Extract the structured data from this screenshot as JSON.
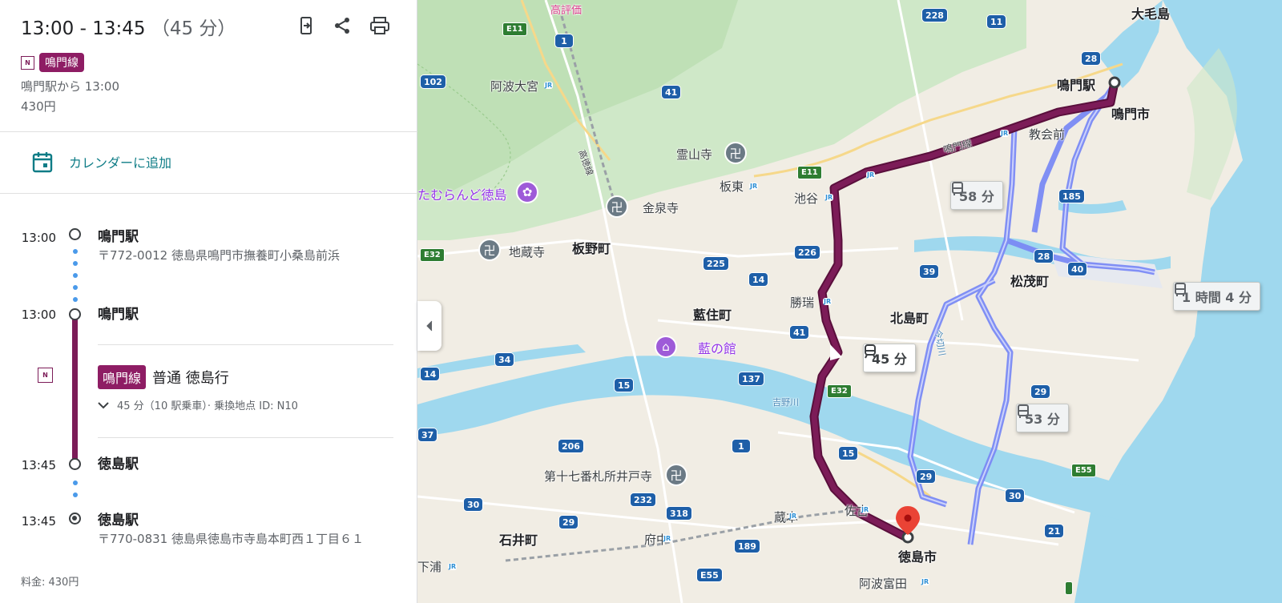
{
  "header": {
    "time_range": "13:00 - 13:45",
    "duration": "（45 分）",
    "line_badge": "N",
    "line_name": "鳴門線",
    "depart_text": "鳴門駅から 13:00",
    "price": "430円"
  },
  "calendar": {
    "label": "カレンダーに追加"
  },
  "itinerary": {
    "stop1": {
      "time": "13:00",
      "name": "鳴門駅",
      "address": "〒772-0012 徳島県鳴門市撫養町小桑島前浜"
    },
    "stop2": {
      "time": "13:00",
      "name": "鳴門駅"
    },
    "ride": {
      "badge": "N",
      "line": "鳴門線",
      "text": "普通 徳島行",
      "detail": "45 分（10 駅乗車）· 乗換地点 ID: N10"
    },
    "stop3": {
      "time": "13:45",
      "name": "徳島駅"
    },
    "stop4": {
      "time": "13:45",
      "name": "徳島駅",
      "address": "〒770-0831 徳島県徳島市寺島本町西１丁目６１"
    },
    "fare": "料金: 430円"
  },
  "map": {
    "places": {
      "naruto_station": "鳴門駅",
      "naruto_city": "鳴門市",
      "omoge": "大毛島",
      "kyokaimae": "教会前",
      "awaomiya": "阿波大宮",
      "ryozenji": "霊山寺",
      "bando": "板東",
      "ikenotani": "池谷",
      "tamuraland": "たむらんど徳島",
      "konsenji": "金泉寺",
      "jizoji": "地蔵寺",
      "itano": "板野町",
      "aizumi": "藍住町",
      "shozui": "勝瑞",
      "kitajima": "北島町",
      "matsushige": "松茂町",
      "ainoyakata": "藍の館",
      "yoshinogawa": "吉野川",
      "idoji": "第十七番札所井戸寺",
      "kuramoto": "蔵本",
      "sako": "佐古",
      "fuchu": "府中",
      "ishii": "石井町",
      "shimoura": "下浦",
      "tokushima_city": "徳島市",
      "awatomida": "阿波富田",
      "kohyoka": "高評価",
      "kotokusen": "高徳線",
      "naruto_line": "鳴門線",
      "imakire": "今切川"
    },
    "callouts": {
      "main": "45 分",
      "alt1": "58 分",
      "alt2": "53 分",
      "alt3": "1 時間 4 分"
    },
    "roads": [
      "228",
      "11",
      "28",
      "1",
      "102",
      "41",
      "E11",
      "E11",
      "185",
      "226",
      "225",
      "14",
      "39",
      "28",
      "40",
      "E32",
      "41",
      "34",
      "14",
      "137",
      "15",
      "E32",
      "29",
      "37",
      "206",
      "1",
      "15",
      "E55",
      "29",
      "30",
      "232",
      "30",
      "29",
      "318",
      "189",
      "21",
      "E55"
    ]
  },
  "colors": {
    "route": "#7c1c58",
    "alt_route": "#7b8af5",
    "water": "#9fd8ee"
  }
}
